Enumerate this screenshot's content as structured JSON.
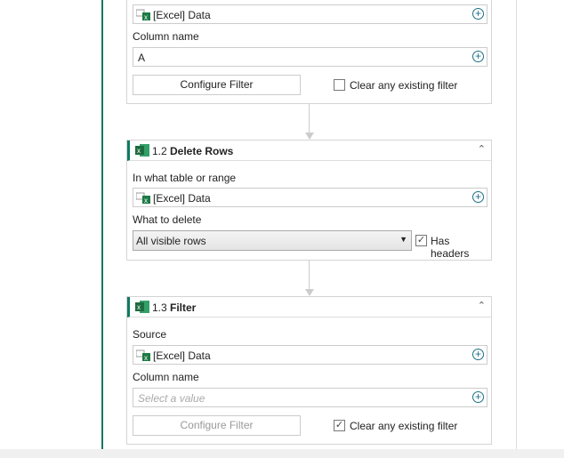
{
  "steps": [
    {
      "source_value": "[Excel] Data",
      "column_label": "Column name",
      "column_value": "A",
      "configure_label": "Configure Filter",
      "clear_label": "Clear any existing filter",
      "clear_checked": false
    },
    {
      "number": "1.2",
      "title": "Delete Rows",
      "table_label": "In what table or range",
      "table_value": "[Excel] Data",
      "delete_label": "What to delete",
      "delete_value": "All visible rows",
      "has_headers_label": "Has headers",
      "has_headers_checked": true
    },
    {
      "number": "1.3",
      "title": "Filter",
      "source_label": "Source",
      "source_value": "[Excel] Data",
      "column_label": "Column name",
      "column_placeholder": "Select a value",
      "configure_label": "Configure Filter",
      "clear_label": "Clear any existing filter",
      "clear_checked": true
    }
  ],
  "colors": {
    "accent": "#0e7a62",
    "excel": "#1d7a44"
  }
}
